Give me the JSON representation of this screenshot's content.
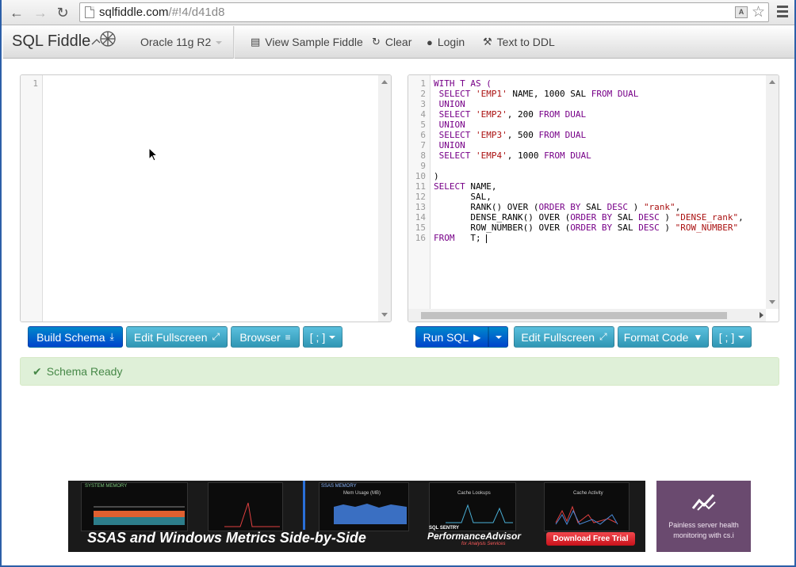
{
  "browser": {
    "url_host": "sqlfiddle.com",
    "url_path": "/#!4/d41d8"
  },
  "navbar": {
    "brand": "SQL Fiddle",
    "database": "Oracle 11g R2",
    "items": [
      {
        "label": "View Sample Fiddle",
        "icon": "list-icon"
      },
      {
        "label": "Clear",
        "icon": "refresh-icon"
      },
      {
        "label": "Login",
        "icon": "user-icon"
      },
      {
        "label": "Text to DDL",
        "icon": "wrench-icon"
      }
    ]
  },
  "schema_editor": {
    "line_numbers": [
      "1"
    ]
  },
  "query_editor": {
    "line_numbers": [
      "1",
      "2",
      "3",
      "4",
      "5",
      "6",
      "7",
      "8",
      "9",
      "10",
      "11",
      "12",
      "13",
      "14",
      "15",
      "16"
    ]
  },
  "schema_buttons": {
    "build": "Build Schema",
    "edit_fullscreen": "Edit Fullscreen",
    "browser": "Browser",
    "terminator": "[ ; ]"
  },
  "query_buttons": {
    "run": "Run SQL",
    "edit_fullscreen": "Edit Fullscreen",
    "format": "Format Code",
    "terminator": "[ ; ]"
  },
  "alert": {
    "text": "Schema Ready"
  },
  "ad": {
    "headline": "SSAS and Windows Metrics Side-by-Side",
    "panel_labels": [
      "SYSTEM MEMORY",
      "SSAS MEMORY",
      "Mem Usage (MB)",
      "Cache Lookups",
      "Cache Activity"
    ],
    "brand_top": "SQL SENTRY",
    "brand": "PerformanceAdvisor",
    "brand_sub": "for Analysis Services",
    "cta": "Download Free Trial"
  },
  "side_ad": {
    "text_line1": "Painless server health",
    "text_line2": "monitoring with cs.i"
  },
  "colors": {
    "primary": "#0055cc",
    "info": "#49afcd",
    "success_bg": "#dff0d8",
    "success_text": "#468847",
    "keyword": "#770088",
    "string": "#aa1111"
  }
}
